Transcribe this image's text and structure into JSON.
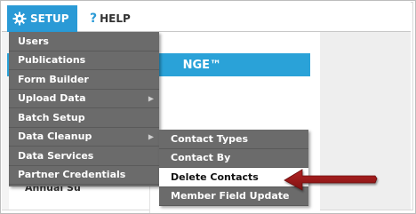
{
  "topbar": {
    "setup_label": "SETUP",
    "help_label": "HELP",
    "help_glyph": "?"
  },
  "background": {
    "banner_text": "NGE™",
    "partial_text": "Annual Su"
  },
  "setup_menu": {
    "items": [
      {
        "label": "Users",
        "has_submenu": false
      },
      {
        "label": "Publications",
        "has_submenu": false
      },
      {
        "label": "Form Builder",
        "has_submenu": false
      },
      {
        "label": "Upload Data",
        "has_submenu": true
      },
      {
        "label": "Batch Setup",
        "has_submenu": false
      },
      {
        "label": "Data Cleanup",
        "has_submenu": true
      },
      {
        "label": "Data Services",
        "has_submenu": false
      },
      {
        "label": "Partner Credentials",
        "has_submenu": false
      }
    ]
  },
  "data_cleanup_submenu": {
    "items": [
      {
        "label": "Contact Types"
      },
      {
        "label": "Contact By"
      },
      {
        "label": "Delete Contacts"
      },
      {
        "label": "Member Field Update"
      }
    ],
    "highlighted_item": "Delete Contacts"
  },
  "icons": {
    "setup": "gear-icon",
    "help": "question-icon",
    "submenu": "triangle-right-icon",
    "pointer": "red-arrow-icon"
  },
  "colors": {
    "accent_blue": "#2a9ad6",
    "menu_bg": "#6b6b6b",
    "highlight_bg": "#ffffff",
    "arrow_red": "#9b1c1c"
  }
}
